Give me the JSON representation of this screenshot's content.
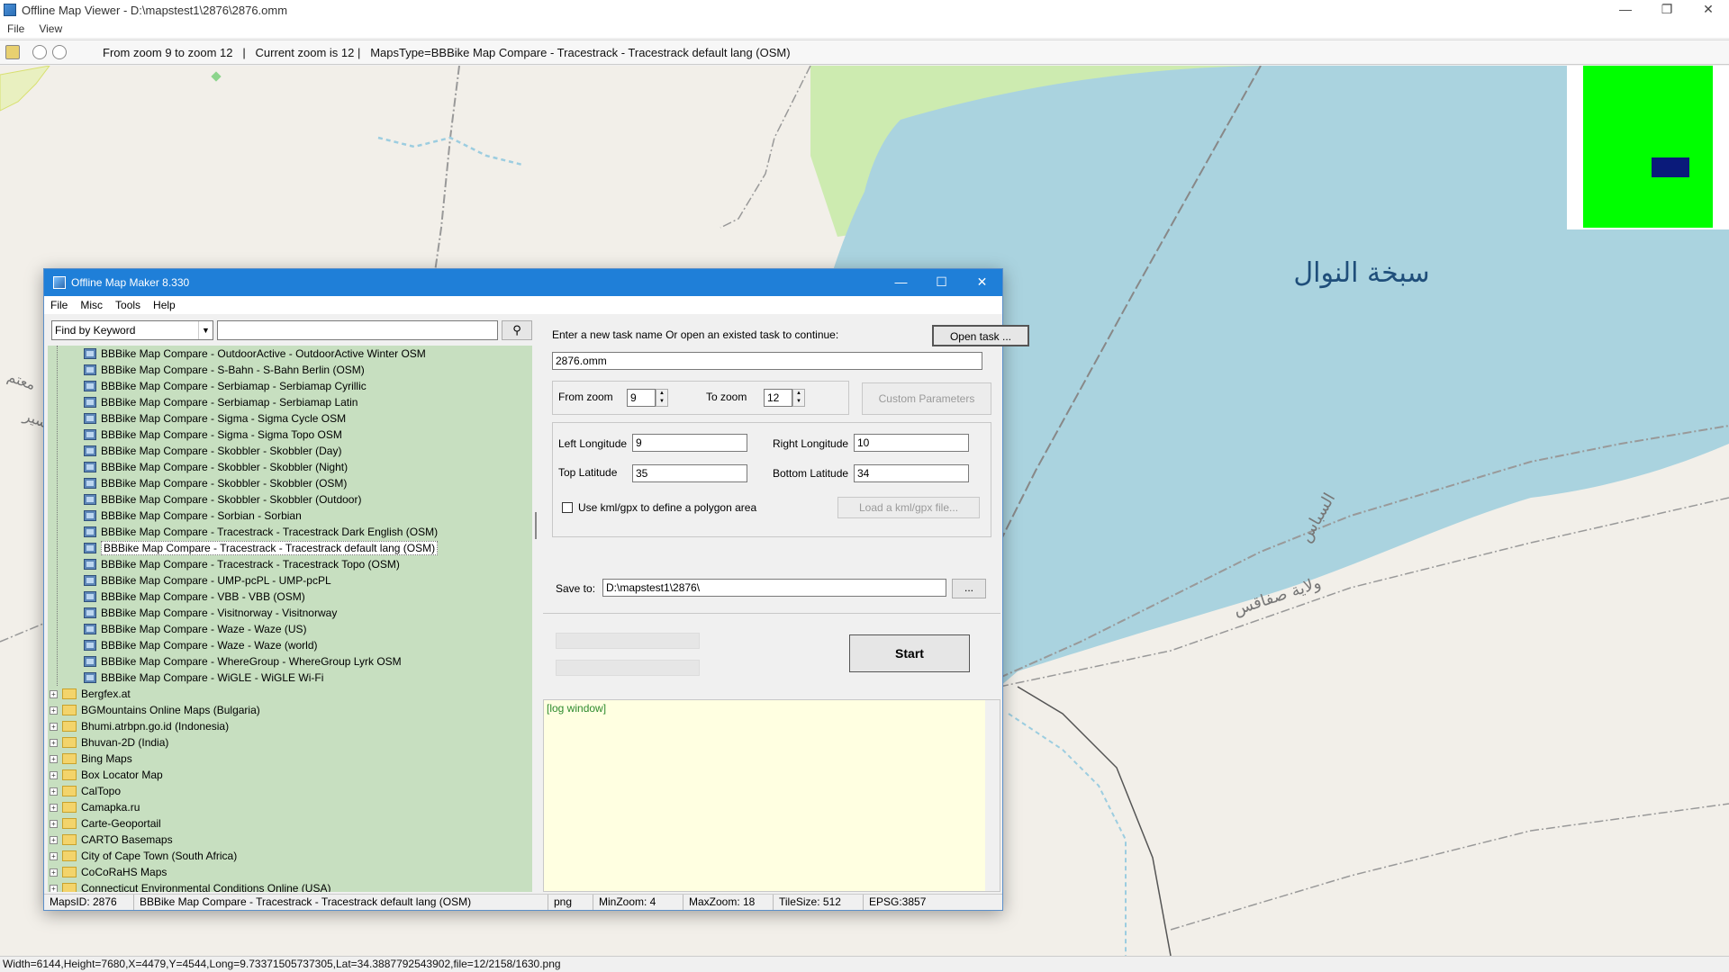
{
  "viewer": {
    "title": "Offline Map Viewer - D:\\mapstest1\\2876\\2876.omm",
    "menu": [
      "File",
      "View"
    ],
    "toolbar_info": "From zoom 9 to zoom 12   |   Current zoom is 12 |   MapsType=BBBike Map Compare - Tracestrack - Tracestrack default lang (OSM)",
    "status": "Width=6144,Height=7680,X=4479,Y=4544,Long=9.73371505737305,Lat=34.3887792543902,file=12/2158/1630.png",
    "window_controls": [
      "—",
      "❐",
      "✕"
    ]
  },
  "map": {
    "label_lake": "سبخة النوال",
    "label_road": "السباس",
    "label_region": "ولاية صفاقس",
    "label_left1": "معتم",
    "label_left2": "سير",
    "colors": {
      "land": "#f2efe9",
      "water": "#aad3df",
      "park": "#cdebb0",
      "minimap_green": "#00ff00",
      "minimap_blue": "#0a1a7a"
    }
  },
  "maker": {
    "title": "Offline Map Maker 8.330",
    "menu": [
      "File",
      "Misc",
      "Tools",
      "Help"
    ],
    "window_controls": [
      "—",
      "☐",
      "✕"
    ],
    "search": {
      "mode": "Find by Keyword",
      "value": "",
      "button_icon": "⚲"
    },
    "tree_leaves": [
      "BBBike Map Compare - OutdoorActive - OutdoorActive Winter OSM",
      "BBBike Map Compare - S-Bahn - S-Bahn Berlin (OSM)",
      "BBBike Map Compare - Serbiamap - Serbiamap Cyrillic",
      "BBBike Map Compare - Serbiamap - Serbiamap Latin",
      "BBBike Map Compare - Sigma - Sigma Cycle OSM",
      "BBBike Map Compare - Sigma - Sigma Topo OSM",
      "BBBike Map Compare - Skobbler - Skobbler (Day)",
      "BBBike Map Compare - Skobbler - Skobbler (Night)",
      "BBBike Map Compare - Skobbler - Skobbler (OSM)",
      "BBBike Map Compare - Skobbler - Skobbler (Outdoor)",
      "BBBike Map Compare - Sorbian - Sorbian",
      "BBBike Map Compare - Tracestrack - Tracestrack Dark English (OSM)",
      "BBBike Map Compare - Tracestrack - Tracestrack default lang (OSM)",
      "BBBike Map Compare - Tracestrack - Tracestrack Topo (OSM)",
      "BBBike Map Compare - UMP-pcPL - UMP-pcPL",
      "BBBike Map Compare - VBB - VBB (OSM)",
      "BBBike Map Compare - Visitnorway - Visitnorway",
      "BBBike Map Compare - Waze - Waze (US)",
      "BBBike Map Compare - Waze - Waze (world)",
      "BBBike Map Compare - WhereGroup - WhereGroup Lyrk OSM",
      "BBBike Map Compare - WiGLE - WiGLE Wi-Fi"
    ],
    "selected_index": 12,
    "tree_folders": [
      "Bergfex.at",
      "BGMountains Online Maps (Bulgaria)",
      "Bhumi.atrbpn.go.id (Indonesia)",
      "Bhuvan-2D (India)",
      "Bing Maps",
      "Box Locator Map",
      "CalTopo",
      "Camapka.ru",
      "Carte-Geoportail",
      "CARTO Basemaps",
      "City of Cape Town (South Africa)",
      "CoCoRaHS Maps",
      "Connecticut Environmental Conditions Online (USA)"
    ],
    "task_prompt": "Enter a new task name Or open an existed task to continue:",
    "open_task_button": "Open task ...",
    "task_name": "2876.omm",
    "from_zoom_label": "From zoom",
    "from_zoom": "9",
    "to_zoom_label": "To zoom",
    "to_zoom": "12",
    "custom_params_button": "Custom Parameters",
    "left_lon_label": "Left Longitude",
    "left_lon": "9",
    "right_lon_label": "Right Longitude",
    "right_lon": "10",
    "top_lat_label": "Top Latitude",
    "top_lat": "35",
    "bottom_lat_label": "Bottom Latitude",
    "bottom_lat": "34",
    "kml_checkbox_label": "Use kml/gpx to define a polygon area",
    "load_kml_button": "Load a kml/gpx file...",
    "save_to_label": "Save to:",
    "save_to": "D:\\mapstest1\\2876\\",
    "browse_button": "...",
    "start_button": "Start",
    "log_text": "[log window]",
    "status": {
      "maps_id": "MapsID: 2876",
      "map_name": "BBBike Map Compare - Tracestrack - Tracestrack default lang (OSM)",
      "format": "png",
      "min_zoom": "MinZoom: 4",
      "max_zoom": "MaxZoom: 18",
      "tile_size": "TileSize: 512",
      "epsg": "EPSG:3857"
    }
  }
}
